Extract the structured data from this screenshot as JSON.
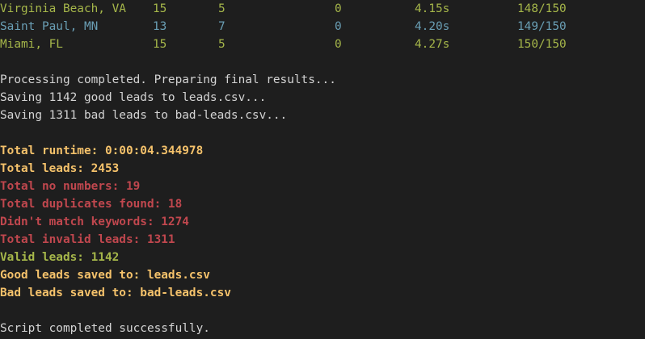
{
  "table_rows": [
    {
      "city": "Virginia Beach, VA",
      "c1": "15",
      "c2": "5",
      "c3": "0",
      "time": "4.15s",
      "progress": "148/150",
      "color": "green"
    },
    {
      "city": "Saint Paul, MN",
      "c1": "13",
      "c2": "7",
      "c3": "0",
      "time": "4.20s",
      "progress": "149/150",
      "color": "blue"
    },
    {
      "city": "Miami, FL",
      "c1": "15",
      "c2": "5",
      "c3": "0",
      "time": "4.27s",
      "progress": "150/150",
      "color": "green"
    }
  ],
  "processing": {
    "line1": "Processing completed. Preparing final results...",
    "line2": "Saving 1142 good leads to leads.csv...",
    "line3": "Saving 1311 bad leads to bad-leads.csv..."
  },
  "summary": {
    "runtime": "Total runtime: 0:00:04.344978",
    "total_leads": "Total leads: 2453",
    "no_numbers": "Total no numbers: 19",
    "duplicates": "Total duplicates found: 18",
    "no_keywords": "Didn't match keywords: 1274",
    "invalid": "Total invalid leads: 1311",
    "valid": "Valid leads: 1142",
    "good_saved": "Good leads saved to: leads.csv",
    "bad_saved": "Bad leads saved to: bad-leads.csv"
  },
  "footer": {
    "completed": "Script completed successfully."
  },
  "colors": {
    "background": "#1e1e1e",
    "blue": "#6a9fb5",
    "green": "#a6b74a",
    "gold": "#f5c26b",
    "red": "#c0474e",
    "white": "#d4d4d4"
  }
}
